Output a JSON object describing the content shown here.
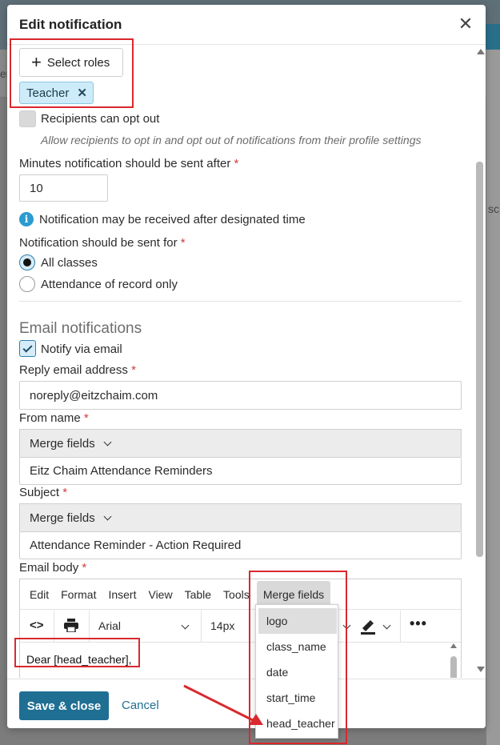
{
  "modal": {
    "title": "Edit notification",
    "close_icon": "close-icon"
  },
  "roles": {
    "select_label": "Select roles",
    "chips": [
      {
        "label": "Teacher"
      }
    ]
  },
  "opt_out": {
    "label": "Recipients can opt out",
    "helper": "Allow recipients to opt in and opt out of notifications from their profile settings",
    "checked": false
  },
  "minutes": {
    "label": "Minutes notification should be sent after",
    "required": "*",
    "value": "10"
  },
  "info": {
    "text": "Notification may be received after designated time"
  },
  "sent_for": {
    "label": "Notification should be sent for",
    "required": "*",
    "options": [
      {
        "label": "All classes",
        "selected": true
      },
      {
        "label": "Attendance of record only",
        "selected": false
      }
    ]
  },
  "email": {
    "section_title": "Email notifications",
    "notify_label": "Notify via email",
    "notify_checked": true,
    "reply_label": "Reply email address",
    "reply_value": "noreply@eitzchaim.com",
    "from_label": "From name",
    "from_merge": "Merge fields",
    "from_value": "Eitz Chaim Attendance Reminders",
    "subject_label": "Subject",
    "subject_merge": "Merge fields",
    "subject_value": "Attendance Reminder - Action Required",
    "body_label": "Email body",
    "required": "*"
  },
  "editor": {
    "menu": [
      "Edit",
      "Format",
      "Insert",
      "View",
      "Table",
      "Tools"
    ],
    "merge_menu": "Merge fields",
    "font_family": "Arial",
    "font_size": "14px",
    "content": "Dear [head_teacher],"
  },
  "merge_dropdown": {
    "items": [
      "logo",
      "class_name",
      "date",
      "start_time",
      "head_teacher"
    ],
    "active_index": 0
  },
  "footer": {
    "save_label": "Save & close",
    "cancel_label": "Cancel"
  },
  "backdrop": {
    "left_text": "er",
    "right_text": "scr"
  },
  "colors": {
    "primary": "#1f6f93",
    "annotation": "#d9282e",
    "chip_bg": "#cdebf8"
  }
}
